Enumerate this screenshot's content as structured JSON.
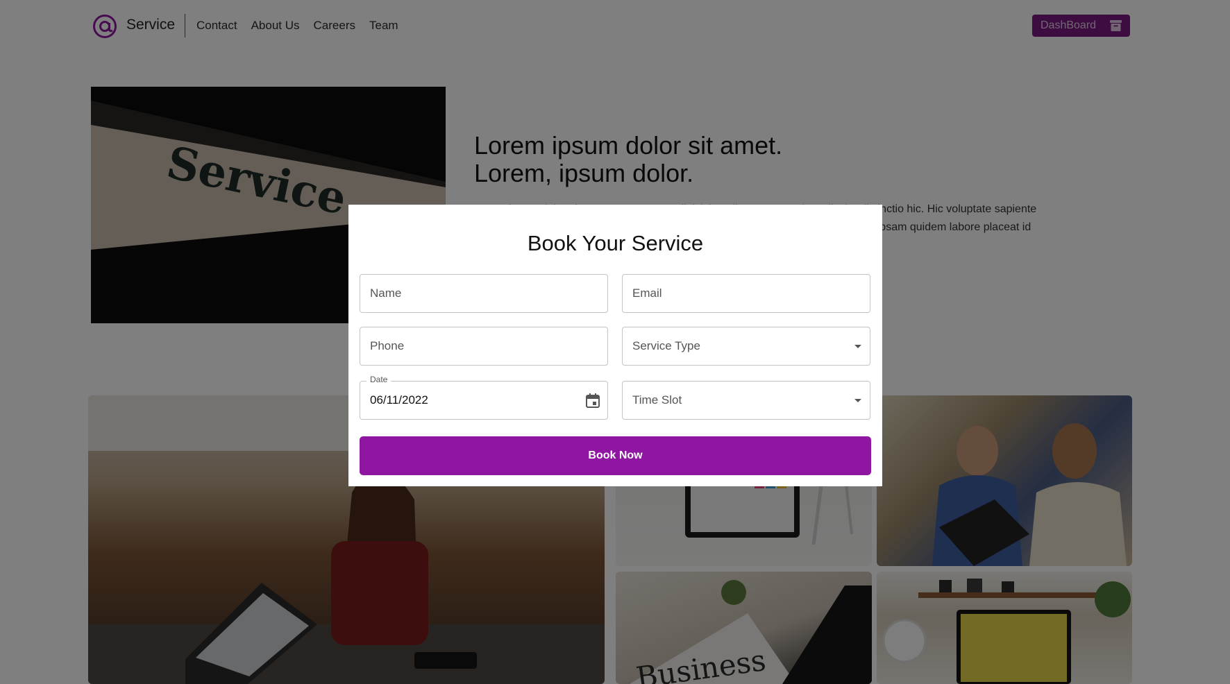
{
  "nav": {
    "brand": "Service",
    "links": [
      "Contact",
      "About Us",
      "Careers",
      "Team"
    ],
    "dashboard_label": "DashBoard"
  },
  "hero": {
    "image_sign_text": "Service",
    "title_line1": "Lorem ipsum dolor sit amet.",
    "title_line2": "Lorem, ipsum dolor.",
    "para_line1": "Lorem ipsum dolor sit amet consectetur adipisicing elit. Iusto magni, explicabo distinctio hic. Hic voluptate sapiente",
    "para_line2": "quaerat illum neque ducimus nobis aliquam. Dolorem alias nemo expedita ipsum. Ipsam quidem labore placeat id"
  },
  "gallery": {
    "newspaper_text": "Business"
  },
  "modal": {
    "title": "Book Your Service",
    "name_placeholder": "Name",
    "email_placeholder": "Email",
    "phone_placeholder": "Phone",
    "service_type_placeholder": "Service Type",
    "date_label": "Date",
    "date_value": "06/11/2022",
    "time_slot_placeholder": "Time Slot",
    "submit_label": "Book Now"
  },
  "colors": {
    "accent": "#8e16a0",
    "dashboard_button": "#7a1a82",
    "overlay": "rgba(0,0,0,0.5)"
  },
  "icons": [
    "at-sign-logo-icon",
    "archive-box-icon",
    "calendar-icon",
    "chevron-down-icon"
  ]
}
